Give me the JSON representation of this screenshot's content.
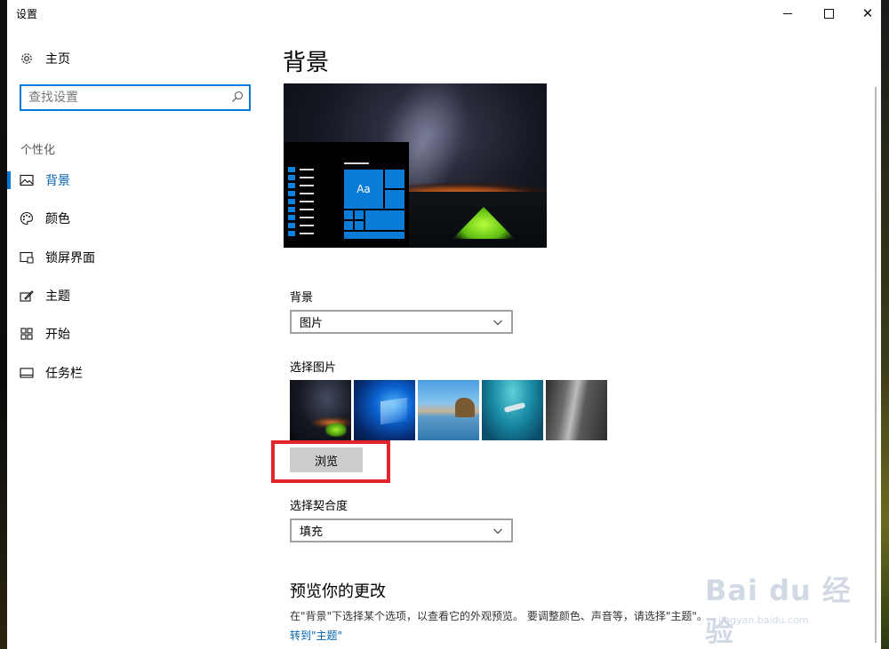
{
  "window": {
    "title": "设置"
  },
  "sidebar": {
    "home_label": "主页",
    "search_placeholder": "查找设置",
    "section_label": "个性化",
    "items": [
      {
        "label": "背景",
        "icon": "picture-icon",
        "active": true
      },
      {
        "label": "颜色",
        "icon": "palette-icon",
        "active": false
      },
      {
        "label": "锁屏界面",
        "icon": "lock-screen-icon",
        "active": false
      },
      {
        "label": "主题",
        "icon": "theme-icon",
        "active": false
      },
      {
        "label": "开始",
        "icon": "start-icon",
        "active": false
      },
      {
        "label": "任务栏",
        "icon": "taskbar-icon",
        "active": false
      }
    ]
  },
  "main": {
    "title": "背景",
    "preview_tile_text": "Aa",
    "background_label": "背景",
    "background_value": "图片",
    "choose_picture_label": "选择图片",
    "browse_label": "浏览",
    "fit_label": "选择契合度",
    "fit_value": "填充",
    "preview_heading": "预览你的更改",
    "preview_desc": "在\"背景\"下选择某个选项，以查看它的外观预览。 要调整颜色、声音等，请选择\"主题\"。",
    "goto_link": "转到\"主题\""
  },
  "watermark": {
    "text": "Bai du 经验",
    "sub": "jingyan.baidu.com"
  },
  "colors": {
    "accent": "#0078d7",
    "highlight_box": "#e5232a",
    "link": "#0063b1"
  }
}
